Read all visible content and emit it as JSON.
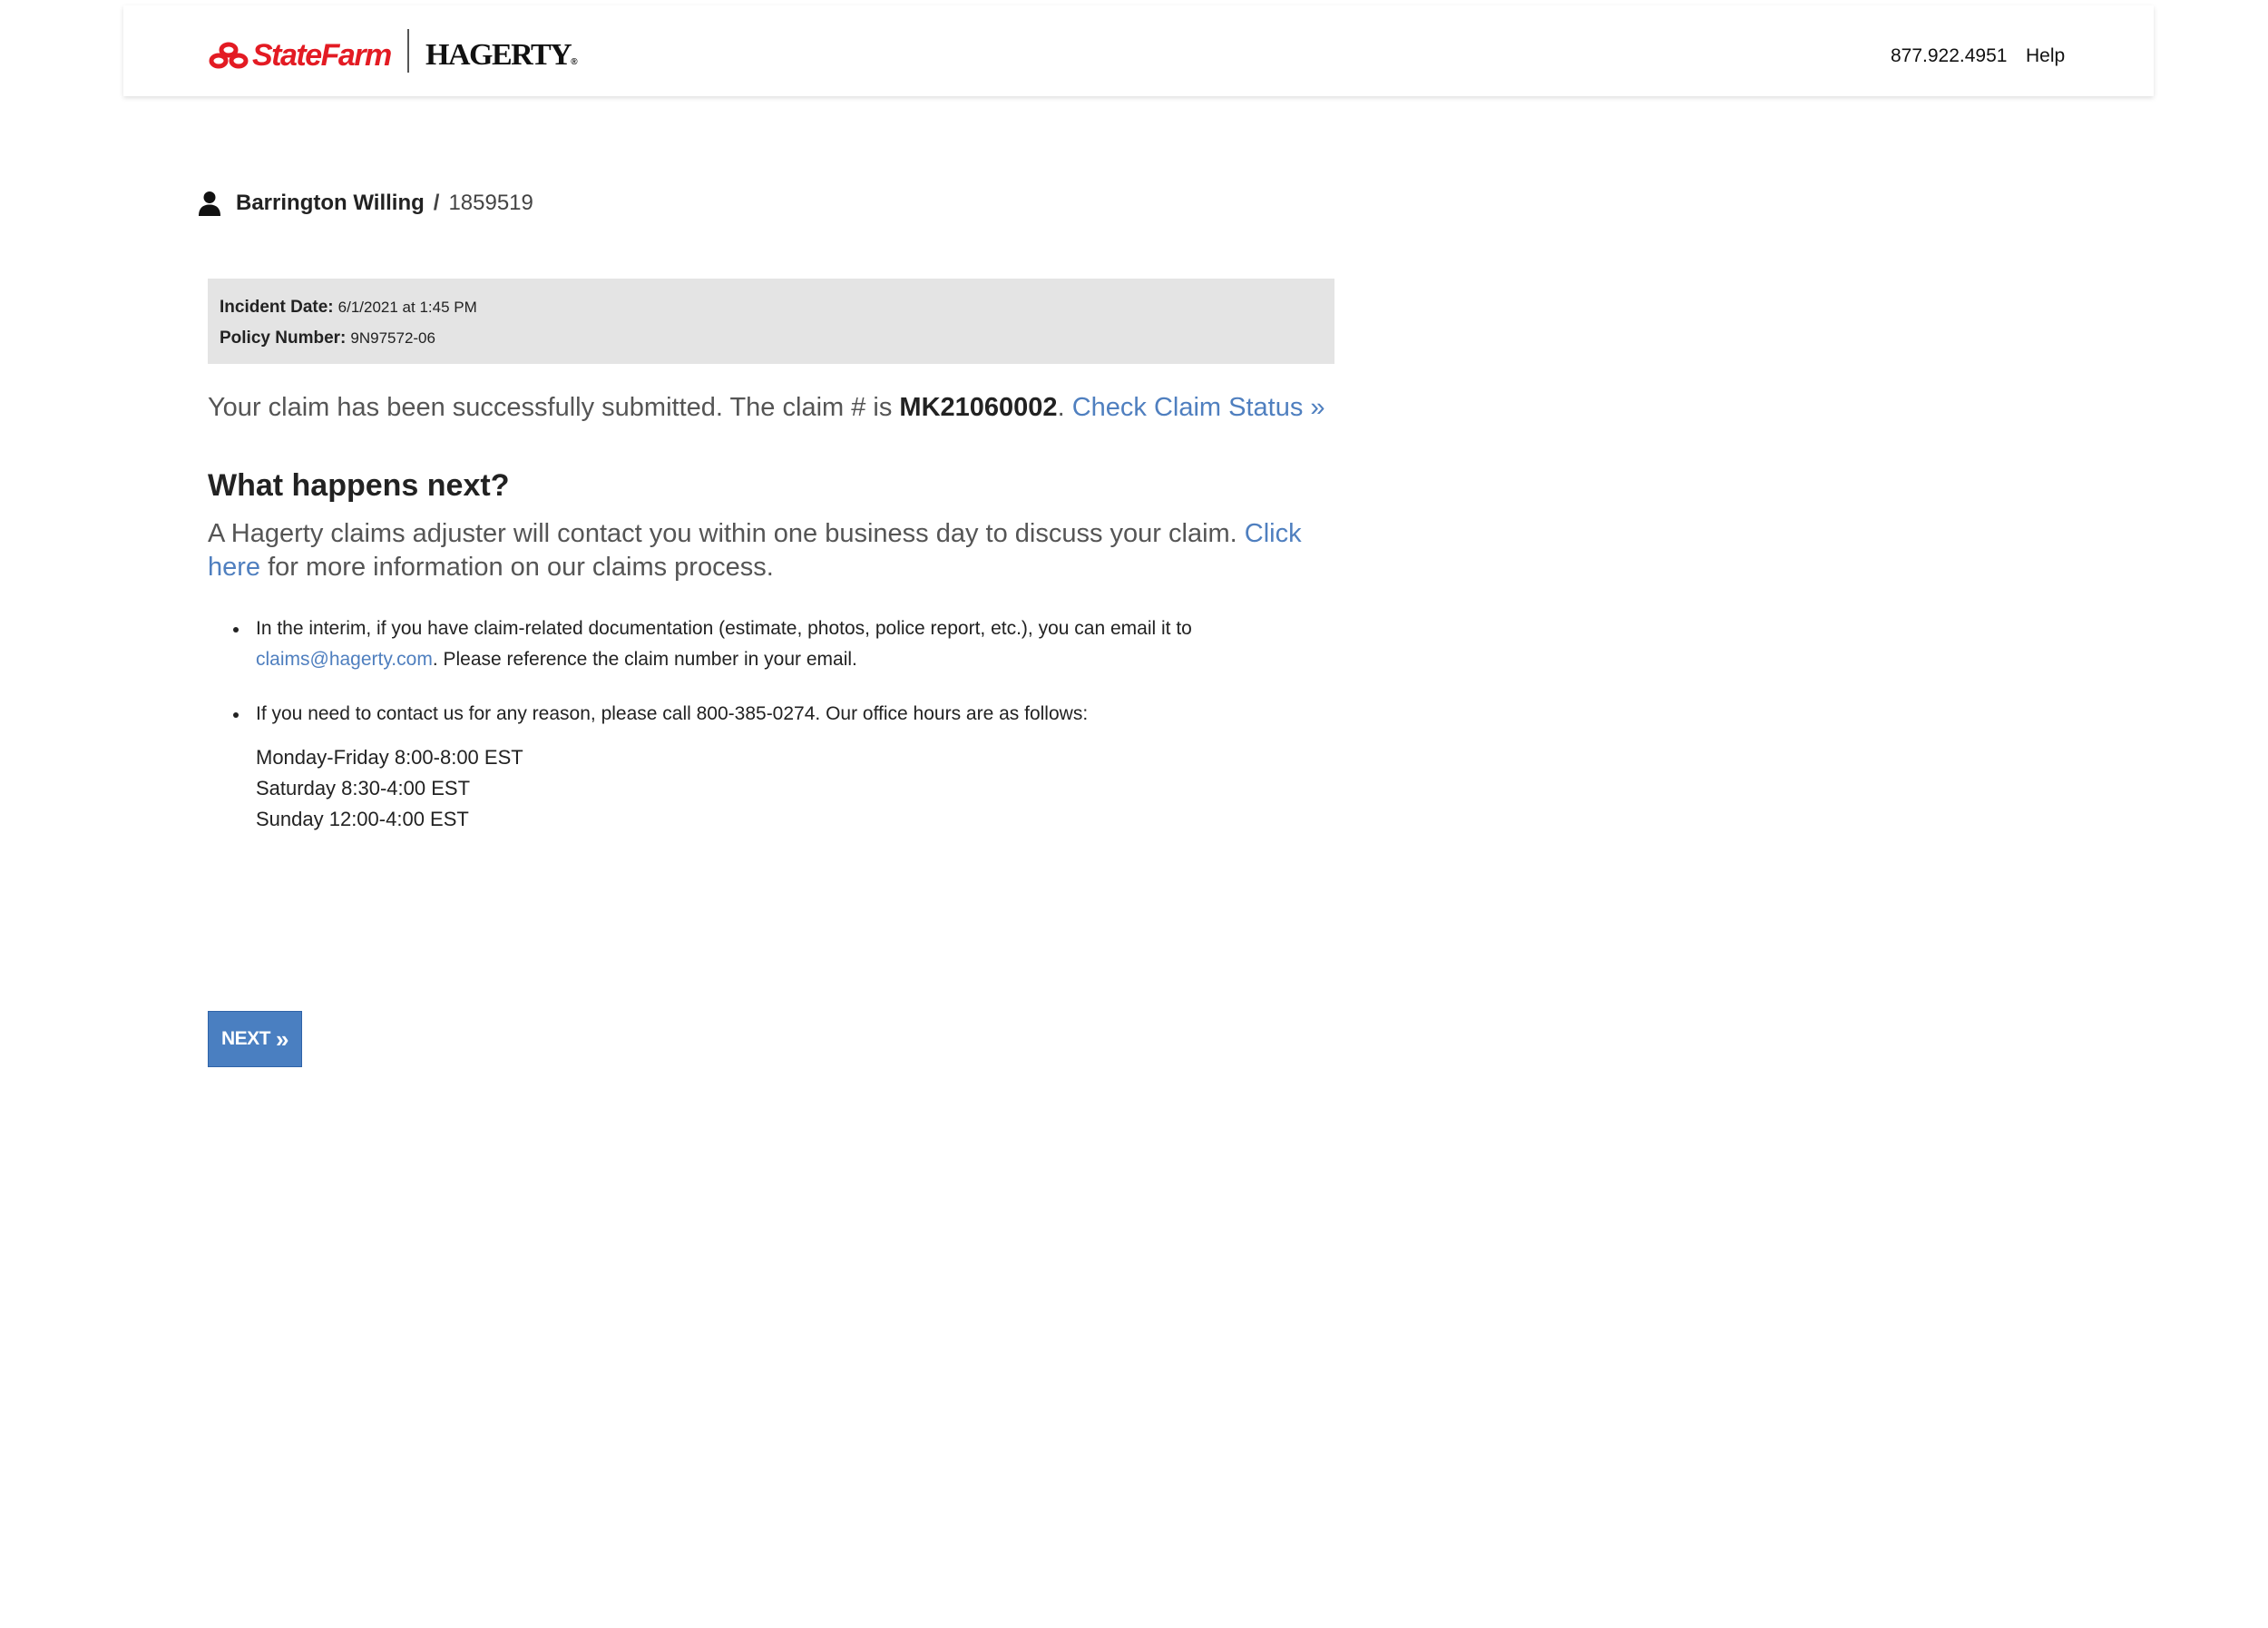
{
  "header": {
    "brand_statefarm": "StateFarm",
    "brand_hagerty": "HAGERTY",
    "brand_hagerty_mark": "®",
    "phone": "877.922.4951",
    "help_label": "Help"
  },
  "user": {
    "name": "Barrington Willing",
    "separator": "/",
    "id": "1859519",
    "icon": "person-icon"
  },
  "info": {
    "incident_label": "Incident Date:",
    "incident_value": "6/1/2021 at 1:45 PM",
    "policy_label": "Policy Number:",
    "policy_value": "9N97572-06"
  },
  "confirmation": {
    "text_before": "Your claim has been successfully submitted. The claim # is ",
    "claim_number": "MK21060002",
    "period": ".",
    "status_link": "Check Claim Status »"
  },
  "next_steps": {
    "heading": "What happens next?",
    "para_before": "A Hagerty claims adjuster will contact you within one business day to discuss your claim. ",
    "click_here": "Click here",
    "para_after": " for more information on our claims process.",
    "bullet1_before": "In the interim, if you have claim-related documentation (estimate, photos, police report, etc.), you can email it to ",
    "email": "claims@hagerty.com",
    "bullet1_after": ". Please reference the claim number in your email.",
    "bullet2": "If you need to contact us for any reason, please call 800-385-0274. Our office hours are as follows:",
    "hours": [
      "Monday-Friday 8:00-8:00 EST",
      "Saturday 8:30-4:00 EST",
      "Sunday 12:00-4:00 EST"
    ]
  },
  "next_button": {
    "label": "NEXT",
    "chevron": "»"
  },
  "colors": {
    "brand_red": "#e31b23",
    "link_blue": "#4f7fbf",
    "button_blue": "#4a7fc1",
    "info_box_gray": "#e4e4e4"
  }
}
